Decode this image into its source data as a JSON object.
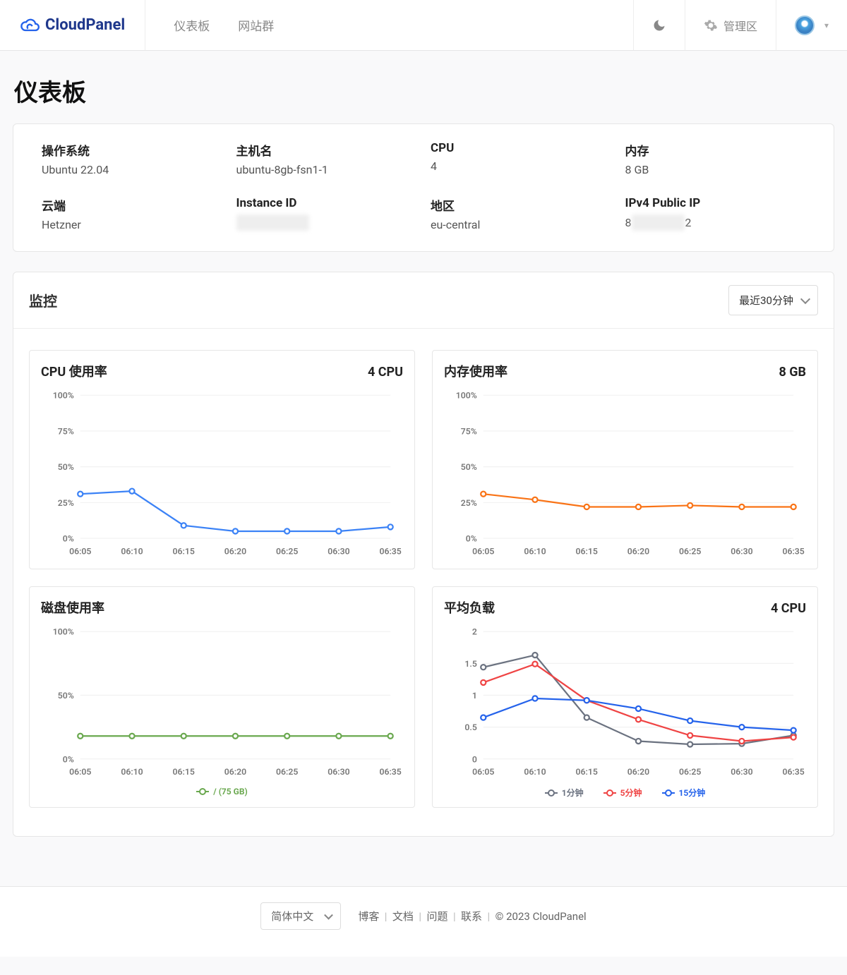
{
  "brand": "CloudPanel",
  "nav": {
    "dashboard": "仪表板",
    "sites": "网站群"
  },
  "header": {
    "admin_area": "管理区"
  },
  "page_title": "仪表板",
  "info": {
    "os_label": "操作系统",
    "os_value": "Ubuntu 22.04",
    "host_label": "主机名",
    "host_value": "ubuntu-8gb-fsn1-1",
    "cpu_label": "CPU",
    "cpu_value": "4",
    "mem_label": "内存",
    "mem_value": "8 GB",
    "cloud_label": "云端",
    "cloud_value": "Hetzner",
    "instance_label": "Instance ID",
    "instance_value": "hidden",
    "region_label": "地区",
    "region_value": "eu-central",
    "ip_label": "IPv4 Public IP",
    "ip_prefix": "8",
    "ip_suffix": "2"
  },
  "monitor": {
    "title": "监控",
    "range": "最近30分钟"
  },
  "chart_titles": {
    "cpu": "CPU 使用率",
    "cpu_right": "4 CPU",
    "mem": "内存使用率",
    "mem_right": "8 GB",
    "disk": "磁盘使用率",
    "load": "平均负载",
    "load_right": "4 CPU"
  },
  "legend": {
    "disk": "/ (75 GB)",
    "m1": "1分钟",
    "m5": "5分钟",
    "m15": "15分钟"
  },
  "chart_data": [
    {
      "type": "line",
      "title": "CPU 使用率",
      "x": [
        "06:05",
        "06:10",
        "06:15",
        "06:20",
        "06:25",
        "06:30",
        "06:35"
      ],
      "ylabel": "%",
      "ylim": [
        0,
        100
      ],
      "yticks": [
        0,
        25,
        50,
        75,
        100
      ],
      "series": [
        {
          "name": "cpu",
          "color": "#3b82f6",
          "values": [
            31,
            33,
            9,
            5,
            5,
            5,
            8
          ]
        }
      ]
    },
    {
      "type": "line",
      "title": "内存使用率",
      "x": [
        "06:05",
        "06:10",
        "06:15",
        "06:20",
        "06:25",
        "06:30",
        "06:35"
      ],
      "ylabel": "%",
      "ylim": [
        0,
        100
      ],
      "yticks": [
        0,
        25,
        50,
        75,
        100
      ],
      "series": [
        {
          "name": "mem",
          "color": "#f97316",
          "values": [
            31,
            27,
            22,
            22,
            23,
            22,
            22
          ]
        }
      ]
    },
    {
      "type": "line",
      "title": "磁盘使用率",
      "x": [
        "06:05",
        "06:10",
        "06:15",
        "06:20",
        "06:25",
        "06:30",
        "06:35"
      ],
      "ylabel": "%",
      "ylim": [
        0,
        100
      ],
      "yticks": [
        0,
        50,
        100
      ],
      "series": [
        {
          "name": "/ (75 GB)",
          "color": "#6aa84f",
          "values": [
            18,
            18,
            18,
            18,
            18,
            18,
            18
          ]
        }
      ]
    },
    {
      "type": "line",
      "title": "平均负载",
      "x": [
        "06:05",
        "06:10",
        "06:15",
        "06:20",
        "06:25",
        "06:30",
        "06:35"
      ],
      "ylabel": "",
      "ylim": [
        0,
        2
      ],
      "yticks": [
        0,
        0.5,
        1,
        1.5,
        2
      ],
      "series": [
        {
          "name": "1分钟",
          "color": "#6b7280",
          "values": [
            1.44,
            1.63,
            0.65,
            0.28,
            0.23,
            0.24,
            0.37
          ]
        },
        {
          "name": "5分钟",
          "color": "#ef4444",
          "values": [
            1.2,
            1.49,
            0.92,
            0.62,
            0.37,
            0.28,
            0.34
          ]
        },
        {
          "name": "15分钟",
          "color": "#2563eb",
          "values": [
            0.65,
            0.95,
            0.92,
            0.79,
            0.6,
            0.5,
            0.45
          ]
        }
      ]
    }
  ],
  "footer": {
    "language": "简体中文",
    "blog": "博客",
    "docs": "文档",
    "issues": "问题",
    "contact": "联系",
    "copyright": "© 2023  CloudPanel"
  }
}
